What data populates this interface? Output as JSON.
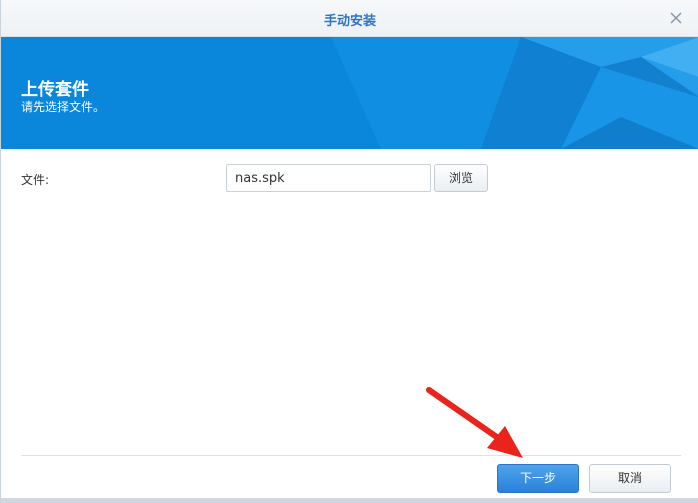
{
  "window": {
    "title": "手动安装"
  },
  "banner": {
    "title": "上传套件",
    "subtitle": "请先选择文件。",
    "color": "#0a86da"
  },
  "form": {
    "file_label": "文件:",
    "file_value": "nas.spk",
    "browse_label": "浏览"
  },
  "footer": {
    "next_label": "下一步",
    "cancel_label": "取消"
  },
  "icons": {
    "close": "close-icon",
    "annotation": "red-arrow-icon"
  },
  "colors": {
    "accent": "#2f73c2",
    "primary_button": "#2a82d8",
    "annotation_arrow": "#e8241c"
  }
}
